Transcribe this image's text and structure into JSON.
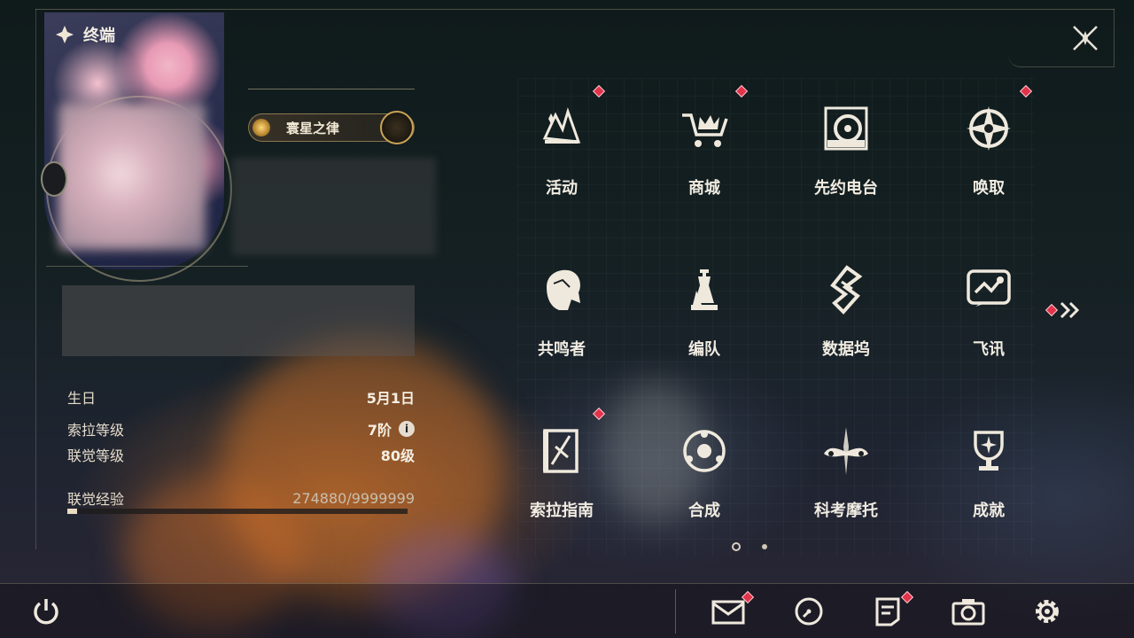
{
  "header": {
    "title": "终端"
  },
  "profile": {
    "badge_label": "寰星之律"
  },
  "info": {
    "birthday_label": "生日",
    "birthday_value": "5月1日",
    "sola_level_label": "索拉等级",
    "sola_level_value": "7阶",
    "union_level_label": "联觉等级",
    "union_level_value": "80级",
    "union_exp_label": "联觉经验",
    "union_exp_value": "274880/9999999",
    "union_exp_fraction": 0.0275
  },
  "menu": {
    "items": [
      {
        "label": "活动",
        "icon": "event-icon",
        "notify": true
      },
      {
        "label": "商城",
        "icon": "shop-icon",
        "notify": true
      },
      {
        "label": "先约电台",
        "icon": "radio-icon",
        "notify": false
      },
      {
        "label": "唤取",
        "icon": "convene-icon",
        "notify": true
      },
      {
        "label": "共鸣者",
        "icon": "resonator-icon",
        "notify": false
      },
      {
        "label": "编队",
        "icon": "team-icon",
        "notify": false
      },
      {
        "label": "数据坞",
        "icon": "data-bank-icon",
        "notify": false
      },
      {
        "label": "飞讯",
        "icon": "message-icon",
        "notify": false
      },
      {
        "label": "索拉指南",
        "icon": "guide-icon",
        "notify": true
      },
      {
        "label": "合成",
        "icon": "synthesis-icon",
        "notify": false
      },
      {
        "label": "科考摩托",
        "icon": "motorcycle-icon",
        "notify": false
      },
      {
        "label": "成就",
        "icon": "achievement-icon",
        "notify": false
      }
    ]
  },
  "pager": {
    "current": 1,
    "total": 2
  },
  "colors": {
    "accent_red": "#e2334a",
    "gold": "#c9a456",
    "text": "#f1ece2"
  }
}
